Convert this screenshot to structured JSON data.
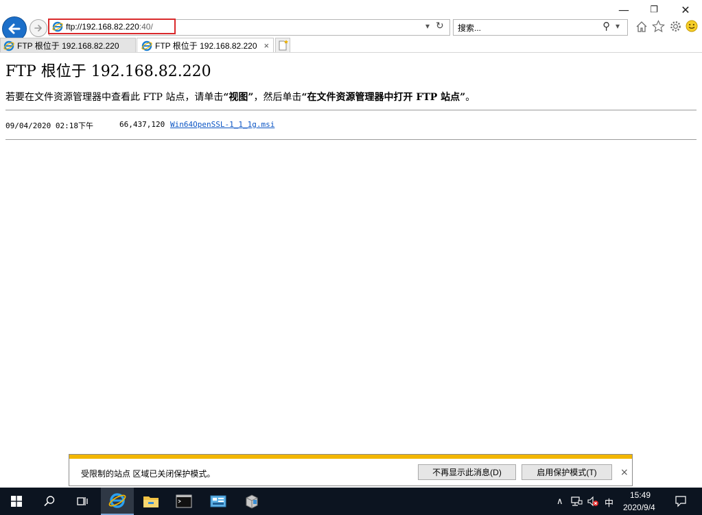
{
  "window": {
    "minimize": "—",
    "restore": "❐",
    "close": "✕"
  },
  "address": {
    "url_main": "ftp://192.168.82.220",
    "url_port": ":40/",
    "dropdown": "▾",
    "refresh": "↻"
  },
  "search": {
    "placeholder": "搜索...",
    "icon_glyph": "⚲",
    "dropdown": "▾"
  },
  "toolbar_icons": [
    "home-icon",
    "favorites-star-icon",
    "gear-icon",
    "smiley-icon"
  ],
  "tabs": [
    {
      "label": "FTP 根位于 192.168.82.220",
      "active": false
    },
    {
      "label": "FTP 根位于 192.168.82.220",
      "active": true,
      "close": "×"
    }
  ],
  "page": {
    "title": "FTP 根位于 192.168.82.220",
    "instruction_pre": "若要在文件资源管理器中查看此 FTP 站点，请单击",
    "instruction_b1": "“视图”",
    "instruction_mid": "，然后单击",
    "instruction_b2": "“在文件资源管理器中打开 FTP 站点”",
    "instruction_post": "。",
    "files": [
      {
        "date": "09/04/2020 02:18下午",
        "size": "66,437,120",
        "name": "Win64OpenSSL-1_1_1g.msi"
      }
    ]
  },
  "infobar": {
    "message": "受限制的站点 区域已关闭保护模式。",
    "dont_show_button": "不再显示此消息(D)",
    "enable_button": "启用保护模式(T)",
    "close": "×"
  },
  "taskbar": {
    "ime": "中",
    "time": "15:49",
    "date": "2020/9/4",
    "chevron": "∧"
  },
  "colors": {
    "accent_blue": "#1c6fc9",
    "infobar_yellow": "#f2b600",
    "highlight_red": "#d9282a",
    "taskbar_bg": "#0c1420"
  }
}
